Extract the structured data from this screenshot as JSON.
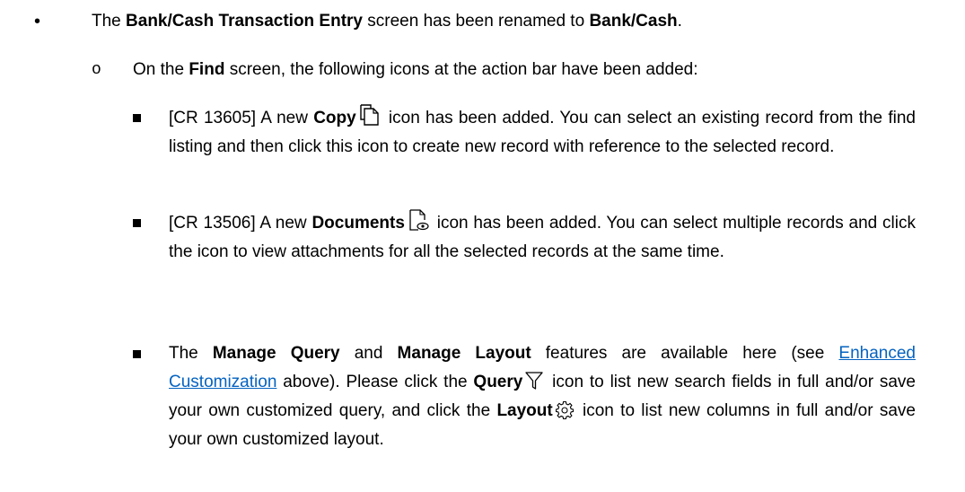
{
  "bullet1": {
    "t1": "The ",
    "b1": "Bank/Cash Transaction Entry",
    "t2": " screen has been renamed to ",
    "b2": "Bank/Cash",
    "t3": "."
  },
  "bullet2": {
    "t1": "On the ",
    "b1": "Find",
    "t2": " screen, the following icons at the action bar have been added:"
  },
  "items": [
    {
      "t1": "[CR 13605] A new ",
      "b1": "Copy",
      "icon": "copy-icon",
      "t2": " icon has been added. You can select an existing record from the find listing and then click this icon to create new record with reference to the selected record."
    },
    {
      "t1": "[CR 13506] A new ",
      "b1": "Documents",
      "icon": "documents-icon",
      "t2": " icon has been added. You can select multiple records and click the icon to view attachments for all the selected records at the same time."
    },
    {
      "t1": "The ",
      "b1": "Manage Query",
      "t2": " and ",
      "b2": "Manage Layout",
      "t3": " features are available here (see ",
      "link": "Enhanced Customization",
      "t4": " above). Please click the ",
      "b3": "Query",
      "icon1": "filter-icon",
      "t5": " icon to list new search fields in full and/or save your own customized query, and click the ",
      "b4": "Layout",
      "icon2": "gear-icon",
      "t6": " icon to list new columns in full and/or save your own customized layout."
    }
  ],
  "colors": {
    "text": "#000000",
    "link": "#0563c1"
  }
}
